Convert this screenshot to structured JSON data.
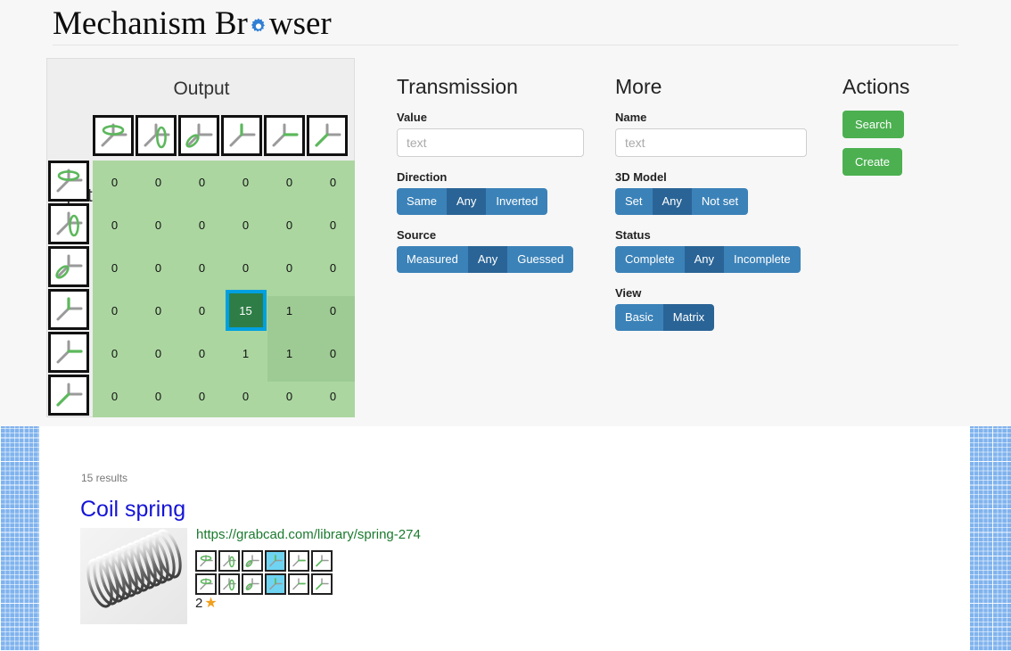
{
  "header": {
    "title_before": "Mechanism Br",
    "title_icon": "gear-icon",
    "title_after": "wser",
    "title_full": "Mechanism Browser"
  },
  "matrix": {
    "output_label": "Output",
    "input_label": "Input",
    "dof_names": [
      "rotation-about-vertical-axis",
      "rotation-about-horizontal-axis",
      "rotation-about-depth-axis",
      "translation-along-vertical-axis",
      "translation-along-horizontal-axis",
      "translation-along-depth-axis"
    ],
    "rows": [
      [
        "0",
        "0",
        "0",
        "0",
        "0",
        "0"
      ],
      [
        "0",
        "0",
        "0",
        "0",
        "0",
        "0"
      ],
      [
        "0",
        "0",
        "0",
        "0",
        "0",
        "0"
      ],
      [
        "0",
        "0",
        "0",
        "15",
        "1",
        "0"
      ],
      [
        "0",
        "0",
        "0",
        "1",
        "1",
        "0"
      ],
      [
        "0",
        "0",
        "0",
        "0",
        "0",
        "0"
      ]
    ],
    "selected_cell": {
      "row": 3,
      "col": 3,
      "value": "15"
    },
    "highlight_region": {
      "row_start": 3,
      "row_end": 4,
      "col_start": 3,
      "col_end": 4
    },
    "colors": {
      "grid_background": "#abd6a0",
      "highlight_background": "#9ecb94",
      "selected_fill": "#2e7d46",
      "selected_border": "#00a0e0"
    }
  },
  "transmission": {
    "heading": "Transmission",
    "value_label": "Value",
    "value_input": "",
    "value_placeholder": "text",
    "direction_label": "Direction",
    "direction_options": [
      "Same",
      "Any",
      "Inverted"
    ],
    "direction_selected": "Any",
    "source_label": "Source",
    "source_options": [
      "Measured",
      "Any",
      "Guessed"
    ],
    "source_selected": "Any"
  },
  "more": {
    "heading": "More",
    "name_label": "Name",
    "name_input": "",
    "name_placeholder": "text",
    "model_label": "3D Model",
    "model_options": [
      "Set",
      "Any",
      "Not set"
    ],
    "model_selected": "Any",
    "status_label": "Status",
    "status_options": [
      "Complete",
      "Any",
      "Incomplete"
    ],
    "status_selected": "Any",
    "view_label": "View",
    "view_options": [
      "Basic",
      "Matrix"
    ],
    "view_selected": "Matrix"
  },
  "actions": {
    "heading": "Actions",
    "search_label": "Search",
    "create_label": "Create"
  },
  "results": {
    "count_text": "15 results",
    "items": [
      {
        "title": "Coil spring",
        "url": "https://grabcad.com/library/spring-274",
        "thumb_alt": "coil-spring-render",
        "rating_value": "2",
        "rating_star": "★",
        "dof_rows": [
          [
            false,
            false,
            false,
            true,
            false,
            false
          ],
          [
            false,
            false,
            false,
            true,
            false,
            false
          ]
        ]
      }
    ]
  },
  "colors": {
    "page_background": "#f7f7f7",
    "panel_background": "#eeeeee",
    "segment_inactive": "#3b82b8",
    "segment_active": "#2a6496",
    "action_green": "#4cb050",
    "link_blue": "#1414d6",
    "url_green": "#1a7a2e",
    "grid_paper_blue": "#80b3ee",
    "star_orange": "#f0a01e",
    "title_accent": "#2f7fd4"
  }
}
